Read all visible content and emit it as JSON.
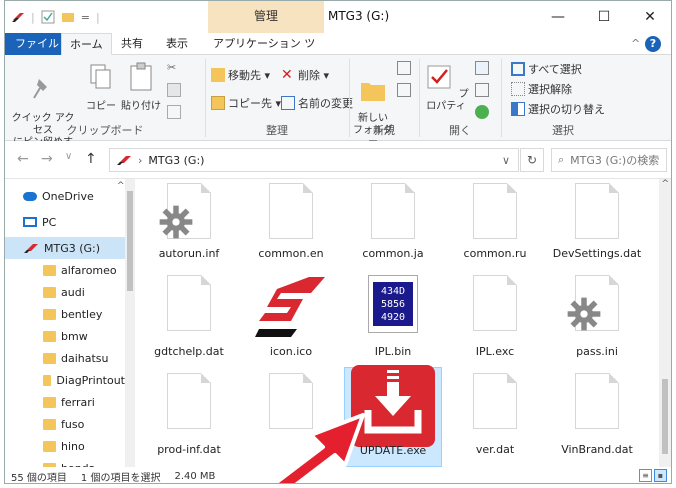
{
  "window": {
    "title": "MTG3 (G:)",
    "context_tab": "管理",
    "minimize": "—",
    "maximize": "☐",
    "close": "✕"
  },
  "tabs": {
    "file": "ファイル",
    "home": "ホーム",
    "share": "共有",
    "view": "表示",
    "app_tools": "アプリケーション ツール",
    "chevron": "^",
    "help": "?"
  },
  "ribbon": {
    "clipboard": {
      "label": "クリップボード",
      "pin": "クイック アクセス\nにピン留めする",
      "copy": "コピー",
      "paste": "貼り付け"
    },
    "organize": {
      "label": "整理",
      "move": "移動先 ▾",
      "delete": "削除 ▾",
      "copy_to": "コピー先 ▾",
      "rename": "名前の変更"
    },
    "new": {
      "label": "新規",
      "new_folder": "新しい\nフォルダー"
    },
    "open": {
      "label": "開く",
      "properties": "プロパティ"
    },
    "select": {
      "label": "選択",
      "all": "すべて選択",
      "none": "選択解除",
      "invert": "選択の切り替え"
    }
  },
  "address": {
    "path": "MTG3 (G:)",
    "search_placeholder": "MTG3 (G:)の検索",
    "refresh": "↻",
    "dropdown": "∨"
  },
  "nav": {
    "items": [
      {
        "label": "OneDrive",
        "icon": "cloud-icon"
      },
      {
        "label": "PC",
        "icon": "pc-icon"
      },
      {
        "label": "MTG3 (G:)",
        "icon": "snapon-drive-icon",
        "selected": true
      },
      {
        "label": "alfaromeo",
        "icon": "folder-icon"
      },
      {
        "label": "audi",
        "icon": "folder-icon"
      },
      {
        "label": "bentley",
        "icon": "folder-icon"
      },
      {
        "label": "bmw",
        "icon": "folder-icon"
      },
      {
        "label": "daihatsu",
        "icon": "folder-icon"
      },
      {
        "label": "DiagPrintout",
        "icon": "folder-icon"
      },
      {
        "label": "ferrari",
        "icon": "folder-icon"
      },
      {
        "label": "fuso",
        "icon": "folder-icon"
      },
      {
        "label": "hino",
        "icon": "folder-icon"
      },
      {
        "label": "honda",
        "icon": "folder-icon"
      }
    ]
  },
  "files": [
    {
      "name": "autorun.inf",
      "icon": "gear-file-icon"
    },
    {
      "name": "common.en",
      "icon": "blank-file-icon"
    },
    {
      "name": "common.ja",
      "icon": "blank-file-icon"
    },
    {
      "name": "common.ru",
      "icon": "blank-file-icon"
    },
    {
      "name": "DevSettings.dat",
      "icon": "blank-file-icon"
    },
    {
      "name": "gdtchelp.dat",
      "icon": "blank-file-icon"
    },
    {
      "name": "icon.ico",
      "icon": "snapon-logo-icon"
    },
    {
      "name": "IPL.bin",
      "icon": "ipl-bin-icon",
      "display": "434D\n5856\n4920"
    },
    {
      "name": "IPL.exc",
      "icon": "blank-file-icon"
    },
    {
      "name": "pass.ini",
      "icon": "gear-file-icon"
    },
    {
      "name": "prod-inf.dat",
      "icon": "blank-file-icon"
    },
    {
      "name": "",
      "icon": "blank-file-icon"
    },
    {
      "name": "UPDATE.exe",
      "icon": "update-download-icon",
      "selected": true
    },
    {
      "name": "ver.dat",
      "icon": "blank-file-icon"
    },
    {
      "name": "VinBrand.dat",
      "icon": "blank-file-icon"
    }
  ],
  "status": {
    "count": "55 個の項目",
    "selection": "1 個の項目を選択",
    "size": "2.40 MB"
  },
  "colors": {
    "accent": "#1a63b8",
    "selected": "#cce8ff",
    "update_red": "#d9282f",
    "arrow_red": "#e5202e"
  }
}
